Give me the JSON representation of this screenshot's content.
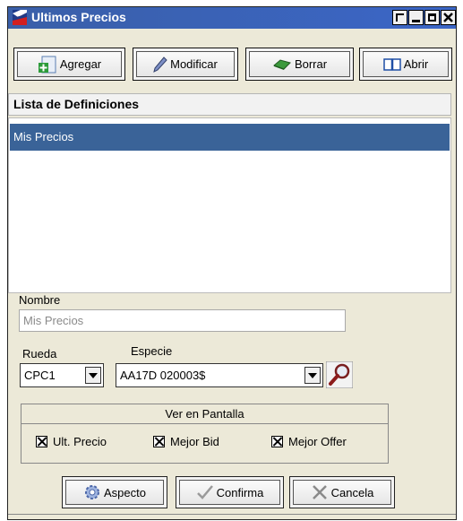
{
  "window": {
    "title": "Ultimos Precios"
  },
  "toolbar": {
    "add_label": "Agregar",
    "edit_label": "Modificar",
    "delete_label": "Borrar",
    "open_label": "Abrir"
  },
  "list": {
    "header": "Lista de Definiciones",
    "items": [
      "Mis Precios"
    ]
  },
  "form": {
    "name_label": "Nombre",
    "name_value": "Mis Precios",
    "rueda_label": "Rueda",
    "rueda_value": "CPC1",
    "especie_label": "Especie",
    "especie_value": "AA17D 020003$"
  },
  "display_group": {
    "title": "Ver en Pantalla",
    "options": [
      {
        "label": "Ult. Precio",
        "checked": true
      },
      {
        "label": "Mejor Bid",
        "checked": true
      },
      {
        "label": "Mejor Offer",
        "checked": true
      }
    ]
  },
  "actions": {
    "aspect_label": "Aspecto",
    "confirm_label": "Confirma",
    "cancel_label": "Cancela"
  }
}
